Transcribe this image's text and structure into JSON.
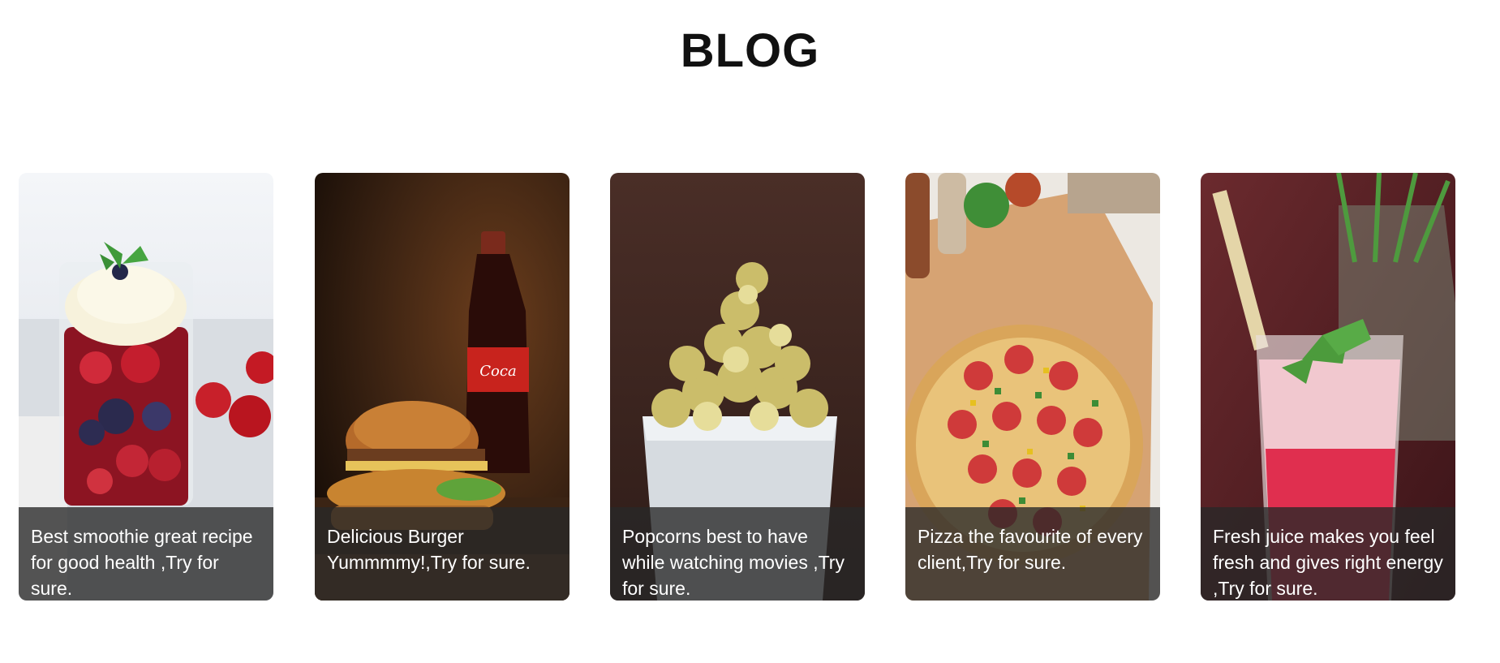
{
  "page": {
    "title": "BLOG"
  },
  "posts": [
    {
      "caption": "Best smoothie great recipe for good health ,Try for sure.",
      "image": "smoothie-image"
    },
    {
      "caption": "Delicious Burger Yummmmy!,Try for sure.",
      "image": "burger-image"
    },
    {
      "caption": "Popcorns best to have while watching movies ,Try for sure.",
      "image": "popcorn-image"
    },
    {
      "caption": "Pizza the favourite of every client,Try for sure.",
      "image": "pizza-image"
    },
    {
      "caption": "Fresh juice makes you feel fresh and gives right energy ,Try for sure.",
      "image": "juice-image"
    }
  ]
}
